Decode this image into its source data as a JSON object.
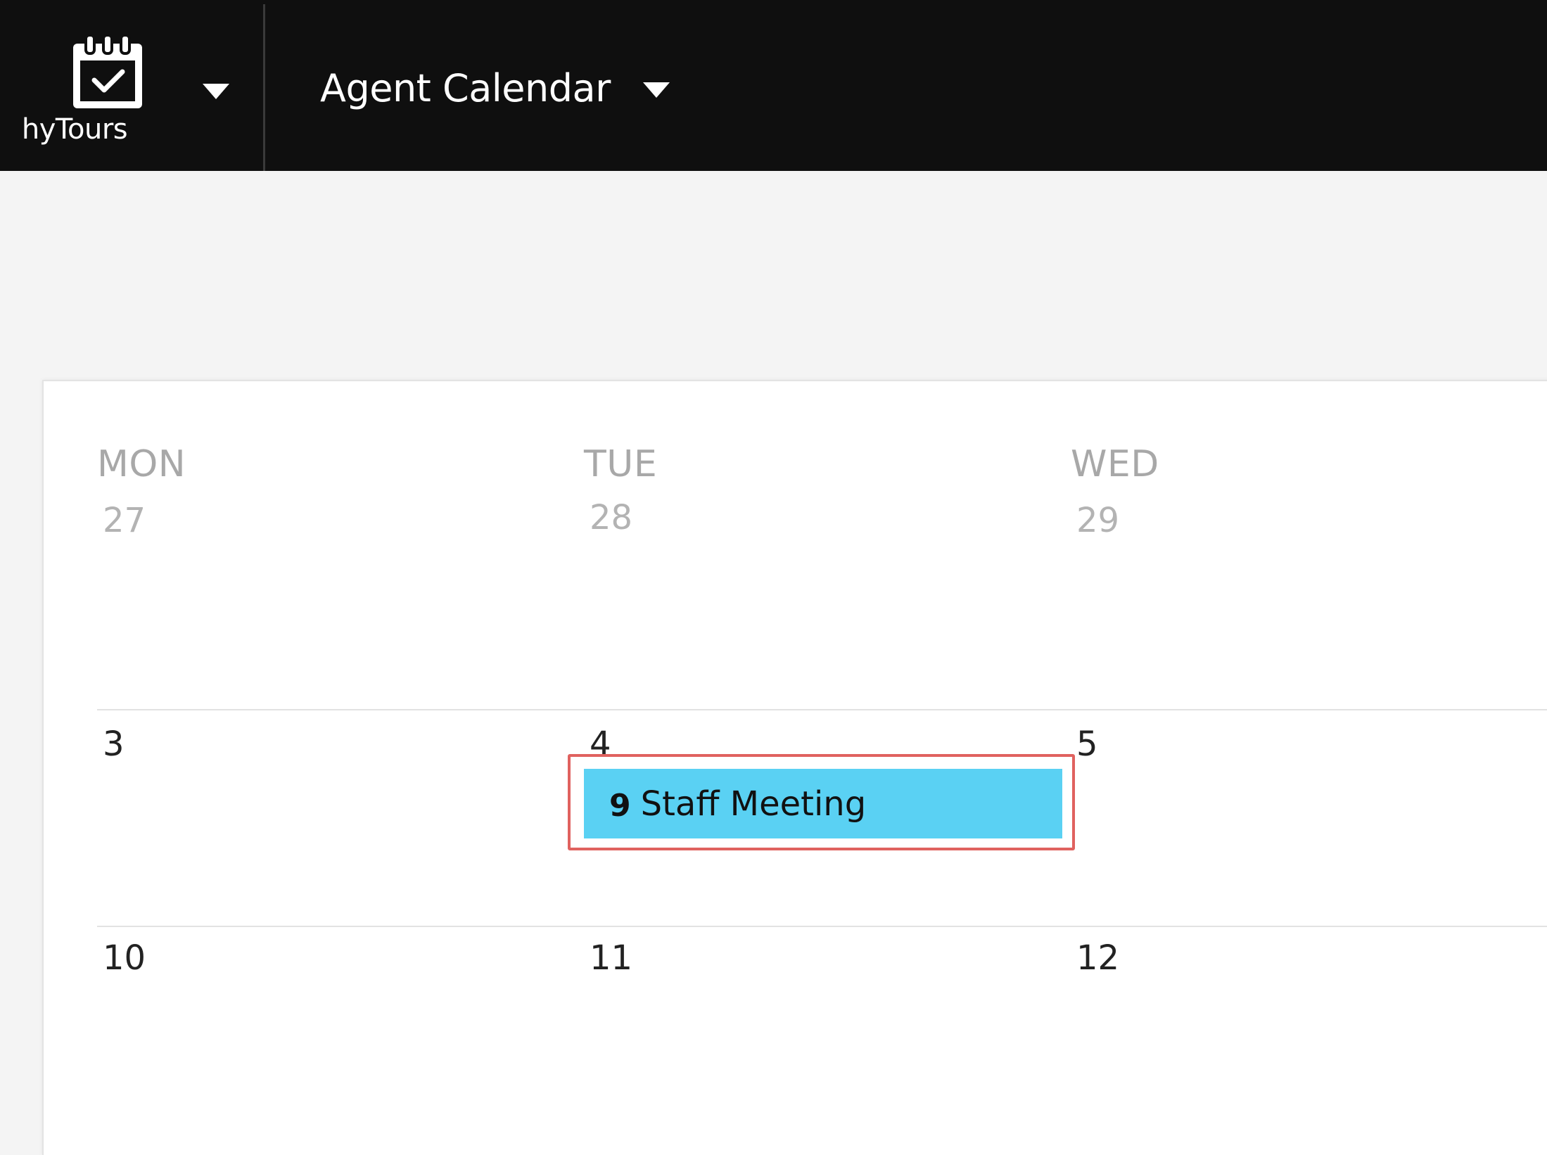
{
  "brand": {
    "name": "hyTours",
    "logo_icon": "calendar-check-icon",
    "menu_icon": "caret-down-icon"
  },
  "app": {
    "title": "Agent Calendar",
    "menu_icon": "caret-down-icon"
  },
  "colors": {
    "topbar": "#0f0f0f",
    "event": "#5ad1f3",
    "focus_ring": "#e0625f",
    "background": "#f4f4f4"
  },
  "calendar": {
    "weekdays": [
      "MON",
      "TUE",
      "WED"
    ],
    "weeks": [
      {
        "dates": [
          "27",
          "28",
          "29"
        ],
        "muted": true
      },
      {
        "dates": [
          "3",
          "4",
          "5"
        ],
        "muted": false
      },
      {
        "dates": [
          "10",
          "11",
          "12"
        ],
        "muted": false
      }
    ],
    "events": [
      {
        "day": "4",
        "time": "9",
        "title": "Staff Meeting",
        "selected": true
      }
    ]
  }
}
